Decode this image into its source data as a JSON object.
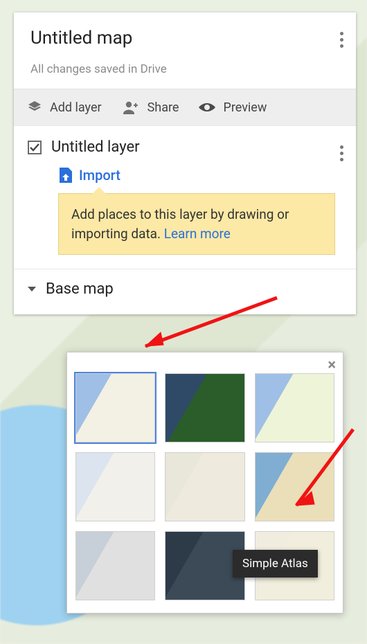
{
  "header": {
    "title": "Untitled map",
    "saved_status": "All changes saved in Drive"
  },
  "toolbar": {
    "add_layer": "Add layer",
    "share": "Share",
    "preview": "Preview"
  },
  "layer": {
    "name": "Untitled layer",
    "checked": true,
    "import_label": "Import",
    "tip_text": "Add places to this layer by drawing or importing data. ",
    "tip_link": "Learn more"
  },
  "basemap": {
    "label": "Base map"
  },
  "style_picker": {
    "close_glyph": "×",
    "styles": [
      {
        "id": "map",
        "selected": true
      },
      {
        "id": "satellite",
        "selected": false
      },
      {
        "id": "terrain",
        "selected": false
      },
      {
        "id": "light-political",
        "selected": false
      },
      {
        "id": "mono-city",
        "selected": false
      },
      {
        "id": "simple-atlas",
        "selected": false
      },
      {
        "id": "light-landmass",
        "selected": false
      },
      {
        "id": "dark-landmass",
        "selected": false
      },
      {
        "id": "whitewater",
        "selected": false
      }
    ],
    "tooltip_label": "Simple Atlas"
  }
}
